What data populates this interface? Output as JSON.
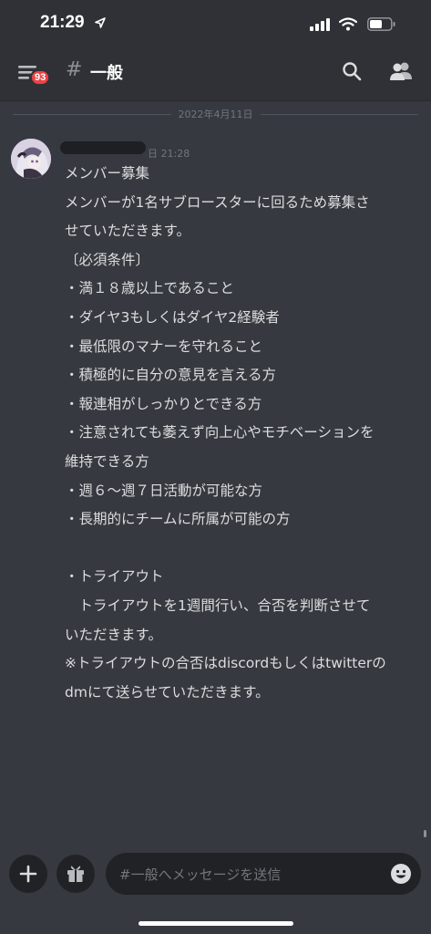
{
  "status_bar": {
    "time": "21:29",
    "icons": [
      "location-arrow-icon",
      "signal-icon",
      "wifi-icon",
      "battery-icon"
    ]
  },
  "header": {
    "badge_count": "93",
    "hash": "#",
    "channel_name": "一般",
    "icons": [
      "hamburger-menu-icon",
      "search-icon",
      "members-icon"
    ]
  },
  "date_divider": "2022年4月11日",
  "message": {
    "timestamp": "日 21:28",
    "lines": [
      "メンバー募集",
      "メンバーが1名サブロースターに回るため募集さ",
      "せていただきます。",
      "〔必須条件〕",
      "・満１８歳以上であること",
      "・ダイヤ3もしくはダイヤ2経験者",
      "・最低限のマナーを守れること",
      "・積極的に自分の意見を言える方",
      "・報連相がしっかりとできる方",
      "・注意されても萎えず向上心やモチベーションを",
      "維持できる方",
      "・週６〜週７日活動が可能な方",
      "・長期的にチームに所属が可能の方",
      "",
      "・トライアウト",
      "　トライアウトを1週間行い、合否を判断させて",
      "いただきます。",
      "※トライアウトの合否はdiscordもしくはtwitterの",
      "dmにて送らせていただきます。"
    ]
  },
  "composer": {
    "placeholder": "#一般へメッセージを送信",
    "icons": [
      "plus-icon",
      "gift-icon",
      "emoji-icon"
    ]
  },
  "colors": {
    "background": "#36393f",
    "header": "#2f3136",
    "input": "#202225",
    "badge": "#ed4245",
    "text": "#dcddde",
    "muted": "#72767d"
  }
}
